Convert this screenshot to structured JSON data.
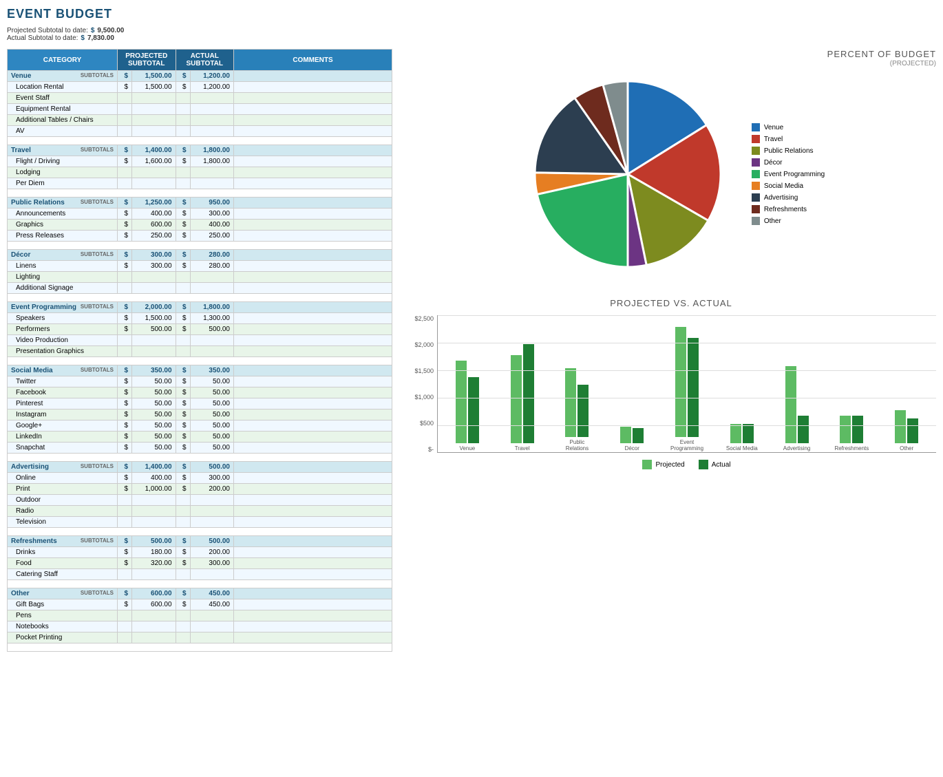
{
  "title": "EVENT BUDGET",
  "summary": {
    "projected_label": "Projected Subtotal to date:",
    "projected_dollar": "$",
    "projected_value": "9,500.00",
    "actual_label": "Actual Subtotal to date:",
    "actual_dollar": "$",
    "actual_value": "7,830.00"
  },
  "table": {
    "headers": {
      "category": "CATEGORY",
      "projected": "PROJECTED SUBTOTAL",
      "actual": "ACTUAL SUBTOTAL",
      "comments": "COMMENTS"
    },
    "sections": [
      {
        "name": "Venue",
        "proj_subtotal": "1,500.00",
        "act_subtotal": "1,200.00",
        "items": [
          {
            "name": "Location Rental",
            "proj": "1,500.00",
            "act": "1,200.00"
          },
          {
            "name": "Event Staff",
            "proj": "",
            "act": ""
          },
          {
            "name": "Equipment Rental",
            "proj": "",
            "act": ""
          },
          {
            "name": "Additional Tables / Chairs",
            "proj": "",
            "act": ""
          },
          {
            "name": "AV",
            "proj": "",
            "act": ""
          }
        ]
      },
      {
        "name": "Travel",
        "proj_subtotal": "1,400.00",
        "act_subtotal": "1,800.00",
        "items": [
          {
            "name": "Flight / Driving",
            "proj": "1,600.00",
            "act": "1,800.00"
          },
          {
            "name": "Lodging",
            "proj": "",
            "act": ""
          },
          {
            "name": "Per Diem",
            "proj": "",
            "act": ""
          }
        ]
      },
      {
        "name": "Public Relations",
        "proj_subtotal": "1,250.00",
        "act_subtotal": "950.00",
        "items": [
          {
            "name": "Announcements",
            "proj": "400.00",
            "act": "300.00"
          },
          {
            "name": "Graphics",
            "proj": "600.00",
            "act": "400.00"
          },
          {
            "name": "Press Releases",
            "proj": "250.00",
            "act": "250.00"
          }
        ]
      },
      {
        "name": "Décor",
        "proj_subtotal": "300.00",
        "act_subtotal": "280.00",
        "items": [
          {
            "name": "Linens",
            "proj": "300.00",
            "act": "280.00"
          },
          {
            "name": "Lighting",
            "proj": "",
            "act": ""
          },
          {
            "name": "Additional Signage",
            "proj": "",
            "act": ""
          }
        ]
      },
      {
        "name": "Event Programming",
        "proj_subtotal": "2,000.00",
        "act_subtotal": "1,800.00",
        "items": [
          {
            "name": "Speakers",
            "proj": "1,500.00",
            "act": "1,300.00"
          },
          {
            "name": "Performers",
            "proj": "500.00",
            "act": "500.00"
          },
          {
            "name": "Video Production",
            "proj": "",
            "act": ""
          },
          {
            "name": "Presentation Graphics",
            "proj": "",
            "act": ""
          }
        ]
      },
      {
        "name": "Social Media",
        "proj_subtotal": "350.00",
        "act_subtotal": "350.00",
        "items": [
          {
            "name": "Twitter",
            "proj": "50.00",
            "act": "50.00"
          },
          {
            "name": "Facebook",
            "proj": "50.00",
            "act": "50.00"
          },
          {
            "name": "Pinterest",
            "proj": "50.00",
            "act": "50.00"
          },
          {
            "name": "Instagram",
            "proj": "50.00",
            "act": "50.00"
          },
          {
            "name": "Google+",
            "proj": "50.00",
            "act": "50.00"
          },
          {
            "name": "LinkedIn",
            "proj": "50.00",
            "act": "50.00"
          },
          {
            "name": "Snapchat",
            "proj": "50.00",
            "act": "50.00"
          }
        ]
      },
      {
        "name": "Advertising",
        "proj_subtotal": "1,400.00",
        "act_subtotal": "500.00",
        "items": [
          {
            "name": "Online",
            "proj": "400.00",
            "act": "300.00"
          },
          {
            "name": "Print",
            "proj": "1,000.00",
            "act": "200.00"
          },
          {
            "name": "Outdoor",
            "proj": "",
            "act": ""
          },
          {
            "name": "Radio",
            "proj": "",
            "act": ""
          },
          {
            "name": "Television",
            "proj": "",
            "act": ""
          }
        ]
      },
      {
        "name": "Refreshments",
        "proj_subtotal": "500.00",
        "act_subtotal": "500.00",
        "items": [
          {
            "name": "Drinks",
            "proj": "180.00",
            "act": "200.00"
          },
          {
            "name": "Food",
            "proj": "320.00",
            "act": "300.00"
          },
          {
            "name": "Catering Staff",
            "proj": "",
            "act": ""
          }
        ]
      },
      {
        "name": "Other",
        "proj_subtotal": "600.00",
        "act_subtotal": "450.00",
        "items": [
          {
            "name": "Gift Bags",
            "proj": "600.00",
            "act": "450.00"
          },
          {
            "name": "Pens",
            "proj": "",
            "act": ""
          },
          {
            "name": "Notebooks",
            "proj": "",
            "act": ""
          },
          {
            "name": "Pocket Printing",
            "proj": "",
            "act": ""
          }
        ]
      }
    ]
  },
  "pie_chart": {
    "title": "PERCENT OF BUDGET",
    "subtitle": "(PROJECTED)",
    "segments": [
      {
        "label": "Venue",
        "value": 1500,
        "pct": "16%",
        "color": "#1f6eb5"
      },
      {
        "label": "Travel",
        "value": 1600,
        "pct": "17%",
        "color": "#c0392b"
      },
      {
        "label": "Public Relations",
        "value": 1250,
        "pct": "13%",
        "color": "#7d8b1f"
      },
      {
        "label": "Décor",
        "value": 300,
        "pct": "3%",
        "color": "#6c3483"
      },
      {
        "label": "Event Programming",
        "value": 2000,
        "pct": "21%",
        "color": "#27ae60"
      },
      {
        "label": "Social Media",
        "value": 350,
        "pct": "4%",
        "color": "#e67e22"
      },
      {
        "label": "Advertising",
        "value": 1400,
        "pct": "15%",
        "color": "#2c3e50"
      },
      {
        "label": "Refreshments",
        "value": 500,
        "pct": "5%",
        "color": "#6e2b1e"
      },
      {
        "label": "Other",
        "value": 400,
        "pct": "6%",
        "color": "#7f8c8d"
      }
    ]
  },
  "bar_chart": {
    "title": "PROJECTED vs. ACTUAL",
    "y_labels": [
      "$2,500",
      "$2,000",
      "$1,500",
      "$1,000",
      "$500",
      "$-"
    ],
    "max_value": 2500,
    "legend_projected": "Projected",
    "legend_actual": "Actual",
    "color_projected": "#27ae60",
    "color_actual": "#1e8449",
    "groups": [
      {
        "label": "Venue",
        "projected": 1500,
        "actual": 1200
      },
      {
        "label": "Travel",
        "projected": 1600,
        "actual": 1800
      },
      {
        "label": "Public Relations",
        "projected": 1250,
        "actual": 950
      },
      {
        "label": "Décor",
        "projected": 300,
        "actual": 280
      },
      {
        "label": "Event Programming",
        "projected": 2000,
        "actual": 1800
      },
      {
        "label": "Social Media",
        "projected": 350,
        "actual": 350
      },
      {
        "label": "Advertising",
        "projected": 1400,
        "actual": 500
      },
      {
        "label": "Refreshments",
        "projected": 500,
        "actual": 500
      },
      {
        "label": "Other",
        "projected": 600,
        "actual": 450
      }
    ]
  }
}
